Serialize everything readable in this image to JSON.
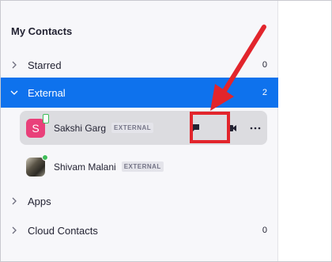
{
  "header": {
    "title": "My Contacts"
  },
  "sections": [
    {
      "label": "Starred",
      "count": "0"
    },
    {
      "label": "External",
      "count": "2"
    },
    {
      "label": "Apps",
      "count": ""
    },
    {
      "label": "Cloud Contacts",
      "count": "0"
    }
  ],
  "contacts": [
    {
      "name": "Sakshi Garg",
      "badge": "EXTERNAL",
      "initial": "S",
      "avatar_color": "#e9407a"
    },
    {
      "name": "Shivam Malani",
      "badge": "EXTERNAL"
    }
  ],
  "colors": {
    "accent": "#0e72ed",
    "annotation": "#e2252c",
    "presence": "#3fbd5a"
  },
  "icons": {
    "chat": "chat-icon",
    "video": "video-icon",
    "more": "more-icon",
    "chevron_right": "chevron-right-icon",
    "chevron_down": "chevron-down-icon"
  }
}
